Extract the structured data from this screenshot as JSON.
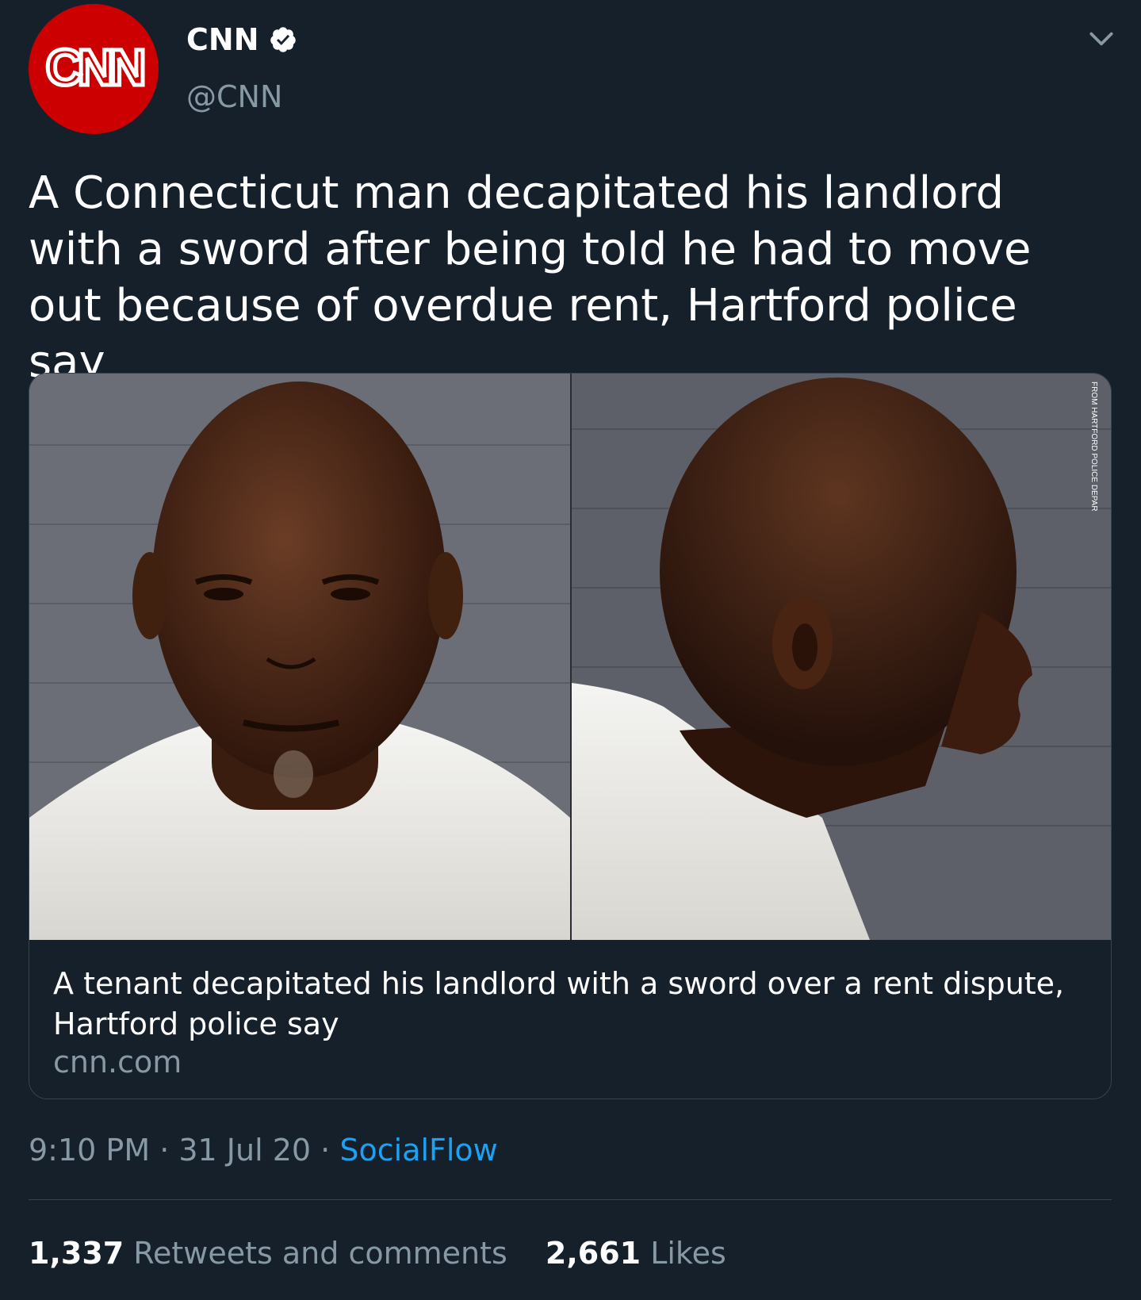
{
  "account": {
    "logo_text": "CNN",
    "display_name": "CNN",
    "handle": "@CNN",
    "verified": true
  },
  "tweet": {
    "text": "A Connecticut man decapitated his landlord with a sword after being told he had to move out because of overdue rent, Hartford police say"
  },
  "card": {
    "image_credit": "FROM HARTFORD POLICE DEPAR",
    "title": "A tenant decapitated his landlord with a sword over a rent dispute, Hartford police say",
    "domain": "cnn.com"
  },
  "meta": {
    "time": "9:10 PM",
    "separator": " · ",
    "date": "31 Jul 20",
    "source": "SocialFlow"
  },
  "stats": {
    "retweets_count": "1,337",
    "retweets_label": "Retweets and comments",
    "likes_count": "2,661",
    "likes_label": "Likes"
  },
  "colors": {
    "background": "#15202b",
    "brand": "#cc0000",
    "link": "#1da1f2",
    "secondary_text": "#8899a6"
  }
}
